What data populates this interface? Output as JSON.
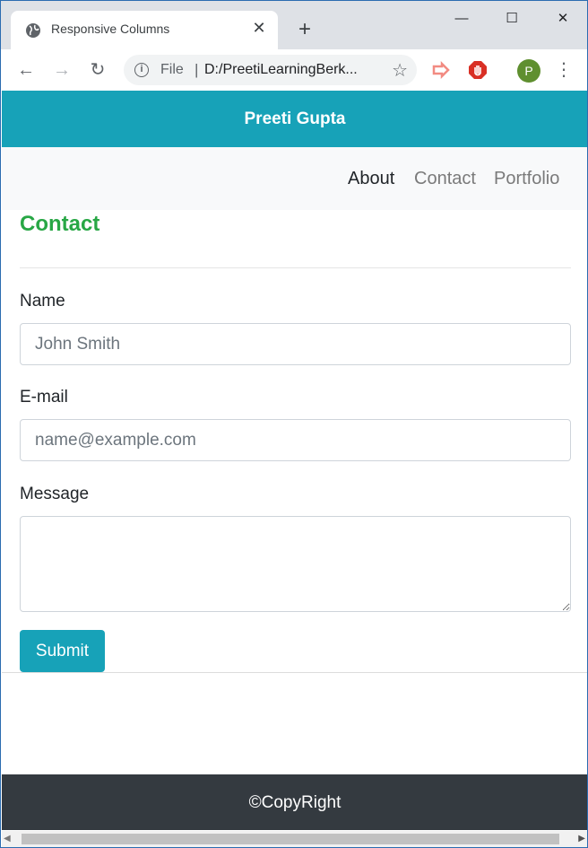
{
  "browser": {
    "tab_title": "Responsive Columns",
    "tab_close": "✕",
    "new_tab": "+",
    "window_controls": {
      "minimize": "—",
      "maximize": "☐",
      "close": "✕"
    },
    "nav": {
      "back": "←",
      "forward": "→",
      "reload": "↻"
    },
    "omnibox": {
      "info": "i",
      "scheme": "File",
      "separator": "|",
      "url": "D:/PreetiLearningBerk...",
      "star": "☆"
    },
    "profile_initial": "P",
    "menu": "⋮"
  },
  "site": {
    "header_title": "Preeti Gupta",
    "nav": {
      "about": "About",
      "contact": "Contact",
      "portfolio": "Portfolio"
    },
    "heading": "Contact",
    "form": {
      "name_label": "Name",
      "name_placeholder": "John Smith",
      "email_label": "E-mail",
      "email_placeholder": "name@example.com",
      "message_label": "Message",
      "submit_label": "Submit"
    },
    "footer": "©CopyRight"
  },
  "colors": {
    "brand": "#17a2b8",
    "heading": "#28a745",
    "footer_bg": "#343a40",
    "navbar_bg": "#f8f9fa"
  }
}
